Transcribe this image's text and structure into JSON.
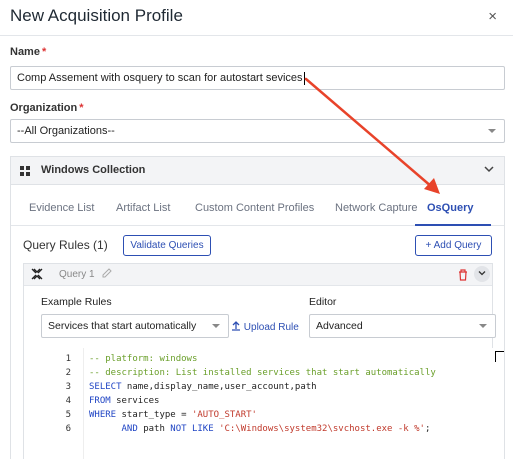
{
  "dialog": {
    "title": "New Acquisition Profile",
    "close_label": "×"
  },
  "name_field": {
    "label": "Name",
    "required_mark": "*",
    "value": "Comp Assement with osquery to scan for autostart sevices"
  },
  "organization": {
    "label": "Organization",
    "required_mark": "*",
    "value": "--All Organizations--"
  },
  "collection": {
    "title": "Windows Collection",
    "chevron": "⌄"
  },
  "tabs": [
    {
      "label": "Evidence List",
      "active": false
    },
    {
      "label": "Artifact List",
      "active": false
    },
    {
      "label": "Custom Content Profiles",
      "active": false
    },
    {
      "label": "Network Capture",
      "active": false
    },
    {
      "label": "OsQuery",
      "active": true
    }
  ],
  "query_rules": {
    "title": "Query Rules (1)",
    "validate_label": "Validate Queries",
    "add_label": "Add Query",
    "add_prefix": "+"
  },
  "query": {
    "name": "Query 1",
    "example_rules_label": "Example Rules",
    "example_rules_value": "Services that start automatically",
    "upload_label": "Upload Rule",
    "editor_label": "Editor",
    "editor_value": "Advanced"
  },
  "code_lines": [
    {
      "n": "1",
      "parts": [
        {
          "c": "cm",
          "t": "-- platform: windows"
        }
      ]
    },
    {
      "n": "2",
      "parts": [
        {
          "c": "cm",
          "t": "-- description: List installed services that start automatically"
        }
      ]
    },
    {
      "n": "3",
      "parts": [
        {
          "c": "kw",
          "t": "SELECT"
        },
        {
          "c": "pl",
          "t": " name,display_name,user_account,path"
        }
      ]
    },
    {
      "n": "4",
      "parts": [
        {
          "c": "kw",
          "t": "FROM"
        },
        {
          "c": "pl",
          "t": " services"
        }
      ]
    },
    {
      "n": "5",
      "parts": [
        {
          "c": "kw",
          "t": "WHERE"
        },
        {
          "c": "pl",
          "t": " start_type = "
        },
        {
          "c": "st",
          "t": "'AUTO_START'"
        }
      ]
    },
    {
      "n": "6",
      "parts": [
        {
          "c": "pl",
          "t": "      "
        },
        {
          "c": "kw",
          "t": "AND"
        },
        {
          "c": "pl",
          "t": " path "
        },
        {
          "c": "kw",
          "t": "NOT LIKE"
        },
        {
          "c": "pl",
          "t": " "
        },
        {
          "c": "st",
          "t": "'C:\\Windows\\system32\\svchost.exe -k %'"
        },
        {
          "c": "pl",
          "t": ";"
        }
      ]
    }
  ],
  "colors": {
    "accent": "#2d4fb3",
    "annotation_arrow": "#e8432a",
    "comment": "#6a9f2a",
    "keyword": "#2045c4",
    "string": "#c0392b"
  },
  "icons": [
    "close-icon",
    "windows-icon",
    "chevron-down-icon",
    "plus-icon",
    "osquery-icon",
    "edit-icon",
    "trash-icon",
    "upload-icon",
    "select-arrow-icon"
  ]
}
